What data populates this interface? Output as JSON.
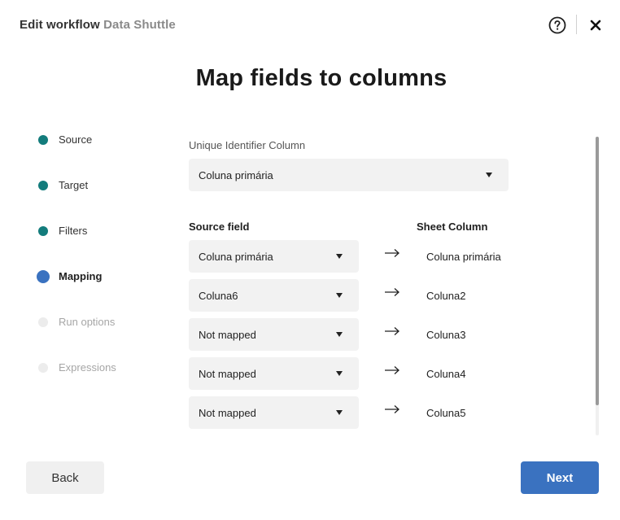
{
  "header": {
    "prefix": "Edit workflow",
    "workflow_name": "Data Shuttle"
  },
  "page_title": "Map fields to columns",
  "steps": [
    {
      "label": "Source",
      "state": "done"
    },
    {
      "label": "Target",
      "state": "done"
    },
    {
      "label": "Filters",
      "state": "done"
    },
    {
      "label": "Mapping",
      "state": "active"
    },
    {
      "label": "Run options",
      "state": "pending"
    },
    {
      "label": "Expressions",
      "state": "pending"
    }
  ],
  "unique_identifier": {
    "label": "Unique Identifier Column",
    "value": "Coluna primária"
  },
  "mapping": {
    "source_header": "Source field",
    "sheet_header": "Sheet Column",
    "rows": [
      {
        "source": "Coluna primária",
        "sheet": "Coluna primária"
      },
      {
        "source": "Coluna6",
        "sheet": "Coluna2"
      },
      {
        "source": "Not mapped",
        "sheet": "Coluna3"
      },
      {
        "source": "Not mapped",
        "sheet": "Coluna4"
      },
      {
        "source": "Not mapped",
        "sheet": "Coluna5"
      }
    ]
  },
  "footer": {
    "back_label": "Back",
    "next_label": "Next"
  },
  "colors": {
    "accent": "#3a72c0",
    "step_done": "#137c7c",
    "step_pending": "#ececec"
  },
  "icons": {
    "help": "help-circle-icon",
    "close": "close-icon",
    "arrow": "arrow-right-icon",
    "caret": "caret-down-icon"
  }
}
